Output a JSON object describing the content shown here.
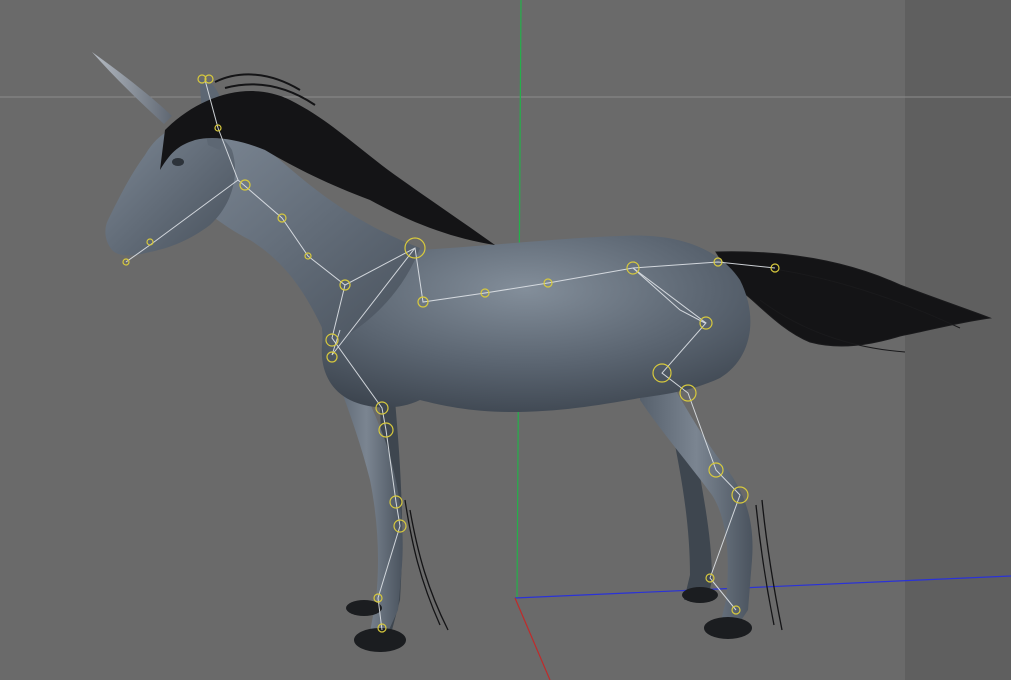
{
  "viewport": {
    "mode": "perspective",
    "background_color": "#6a6a6a",
    "safe_frame_shade_color": "#5e5e5e"
  },
  "axes": {
    "x_color": "#2a32d8",
    "y_color": "#24b04a",
    "z_color": "#c02a2a"
  },
  "model": {
    "subject": "unicorn",
    "body_color": "#4d5763",
    "body_highlight_color": "#7c8794",
    "mane_color": "#141416",
    "horn_color": "#8b939d"
  },
  "rig": {
    "bone_color": "#dfe3e8",
    "joint_color": "#d7c93d"
  }
}
